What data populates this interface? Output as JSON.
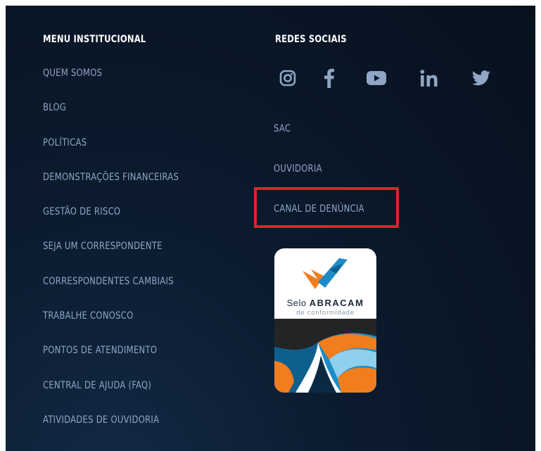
{
  "menu_institucional": {
    "heading": "MENU INSTITUCIONAL",
    "items": [
      "QUEM SOMOS",
      "BLOG",
      "POLÍTICAS",
      "DEMONSTRAÇÕES FINANCEIRAS",
      "GESTÃO DE RISCO",
      "SEJA UM CORRESPONDENTE",
      "CORRESPONDENTES CAMBIAIS",
      "TRABALHE CONOSCO",
      "PONTOS DE ATENDIMENTO",
      "CENTRAL DE AJUDA (FAQ)",
      "ATIVIDADES DE OUVIDORIA"
    ]
  },
  "redes_sociais": {
    "heading": "REDES SOCIAIS",
    "icons": [
      "instagram-icon",
      "facebook-icon",
      "youtube-icon",
      "linkedin-icon",
      "twitter-icon"
    ],
    "links": [
      "SAC",
      "OUVIDORIA",
      "CANAL DE DENÚNCIA"
    ]
  },
  "seal": {
    "line1_regular": "Selo ",
    "line1_bold": "ABRACAM",
    "line2": "de conformidade"
  },
  "colors": {
    "background": "#0b1a2d",
    "link": "#8fa6c4",
    "heading": "#ffffff",
    "highlight": "#e3212d",
    "seal_orange": "#f07d1e",
    "seal_blue": "#1d8cc6"
  }
}
